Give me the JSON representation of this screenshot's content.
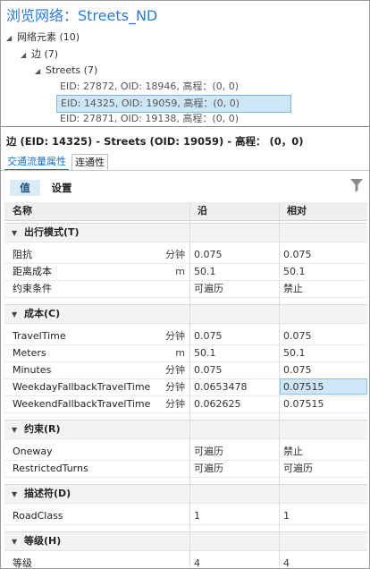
{
  "title": "浏览网络：Streets_ND",
  "tree": {
    "root": {
      "label": "网络元素",
      "count": "(10)"
    },
    "edge": {
      "label": "边",
      "count": "(7)"
    },
    "streets": {
      "label": "Streets",
      "count": "(7)"
    },
    "leaves": [
      "EID: 27872, OID: 18946, 高程：(0, 0)",
      "EID: 14325, OID: 19059, 高程：(0, 0)",
      "EID: 27871, OID: 19138, 高程：(0, 0)"
    ]
  },
  "detail_header": "边 (EID: 14325) - Streets (OID: 19059) - 高程：  (0，0)",
  "tabs": [
    "交通流量属性",
    "连通性"
  ],
  "buttons": {
    "value": "值",
    "settings": "设置"
  },
  "columns": {
    "name": "名称",
    "along": "沿",
    "against": "相对"
  },
  "groups": [
    {
      "title": "出行模式(T)",
      "rows": [
        {
          "name": "阻抗",
          "unit": "分钟",
          "along": "0.075",
          "against": "0.075"
        },
        {
          "name": "距离成本",
          "unit": "m",
          "along": "50.1",
          "against": "50.1"
        },
        {
          "name": "约束条件",
          "unit": "",
          "along": "可遍历",
          "against": "禁止"
        }
      ]
    },
    {
      "title": "成本(C)",
      "rows": [
        {
          "name": "TravelTime",
          "unit": "分钟",
          "along": "0.075",
          "against": "0.075"
        },
        {
          "name": "Meters",
          "unit": "m",
          "along": "50.1",
          "against": "50.1"
        },
        {
          "name": "Minutes",
          "unit": "分钟",
          "along": "0.075",
          "against": "0.075"
        },
        {
          "name": "WeekdayFallbackTravelTime",
          "unit": "分钟",
          "along": "0.0653478",
          "against": "0.07515"
        },
        {
          "name": "WeekendFallbackTravelTime",
          "unit": "分钟",
          "along": "0.062625",
          "against": "0.07515"
        }
      ]
    },
    {
      "title": "约束(R)",
      "rows": [
        {
          "name": "Oneway",
          "unit": "",
          "along": "可遍历",
          "against": "禁止"
        },
        {
          "name": "RestrictedTurns",
          "unit": "",
          "along": "可遍历",
          "against": "可遍历"
        }
      ]
    },
    {
      "title": "描述符(D)",
      "rows": [
        {
          "name": "RoadClass",
          "unit": "",
          "along": "1",
          "against": "1"
        }
      ]
    },
    {
      "title": "等级(H)",
      "rows": [
        {
          "name": "等级",
          "unit": "",
          "along": "4",
          "against": "4"
        }
      ]
    }
  ]
}
